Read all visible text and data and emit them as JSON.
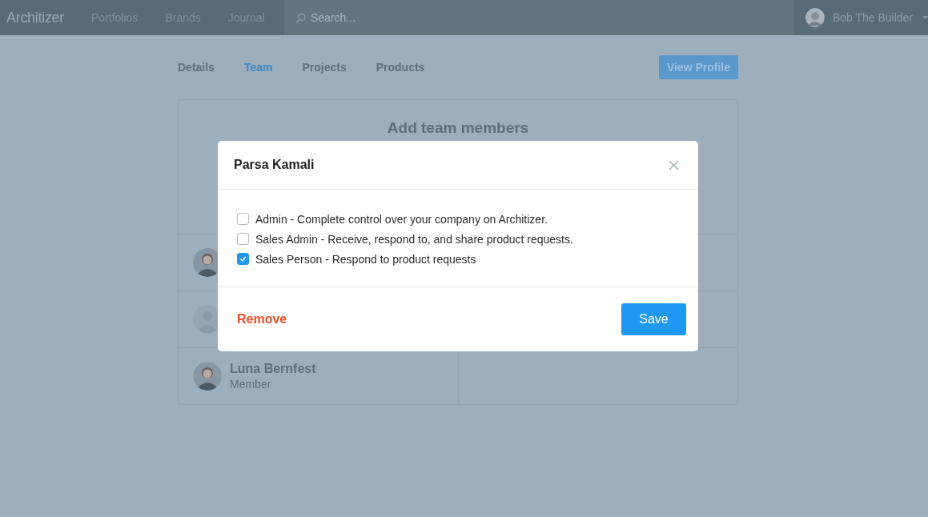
{
  "nav": {
    "logo": "Architizer",
    "links": [
      "Portfolios",
      "Brands",
      "Journal"
    ],
    "search": {
      "placeholder": "Search..."
    },
    "user": {
      "name": "Bob The Builder"
    }
  },
  "tabs": [
    {
      "label": "Details",
      "selected": false
    },
    {
      "label": "Team",
      "selected": true
    },
    {
      "label": "Projects",
      "selected": false
    },
    {
      "label": "Products",
      "selected": false
    }
  ],
  "view_profile_button": "View Profile",
  "card": {
    "heading": "Add team members",
    "members": [
      {
        "kind": "photo"
      },
      {
        "kind": "silhouette"
      },
      {
        "kind": "photo",
        "name": "Luna Bernfest",
        "role": "Member"
      }
    ]
  },
  "modal": {
    "title": "Parsa Kamali",
    "roles": [
      {
        "label": "Admin - Complete control over your company on Architizer.",
        "checked": false
      },
      {
        "label": "Sales Admin - Receive, respond to, and share product requests.",
        "checked": false
      },
      {
        "label": "Sales Person - Respond to product requests",
        "checked": true
      }
    ],
    "remove": "Remove",
    "save": "Save"
  }
}
